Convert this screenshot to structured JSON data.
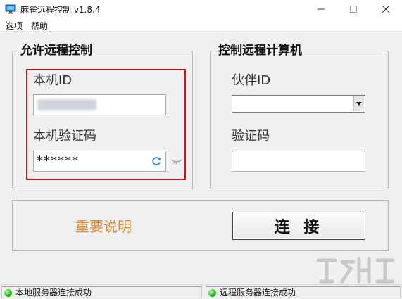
{
  "window": {
    "title": "麻雀远程控制 v1.8.4",
    "controls": {
      "minimize_icon": "minimize-icon",
      "maximize_icon": "maximize-icon",
      "close_icon": "close-icon"
    }
  },
  "menu": {
    "items": [
      {
        "label": "选项"
      },
      {
        "label": "帮助"
      }
    ]
  },
  "allow_panel": {
    "title": "允许远程控制",
    "id_label": "本机ID",
    "id_value_obscured": true,
    "code_label": "本机验证码",
    "code_value": "******",
    "refresh_icon": "refresh-icon",
    "show_password_icon": "eye-closed-icon"
  },
  "control_panel": {
    "title": "控制远程计算机",
    "partner_label": "伙伴ID",
    "partner_value": "",
    "code_label": "验证码",
    "code_value": ""
  },
  "actions": {
    "notice_label": "重要说明",
    "connect_label": "连 接"
  },
  "status": {
    "local": "本地服务器连接成功",
    "remote": "远程服务器连接成功",
    "ok_color": "#22b51f"
  },
  "colors": {
    "highlight": "#c8161d",
    "notice": "#e08b2c"
  }
}
